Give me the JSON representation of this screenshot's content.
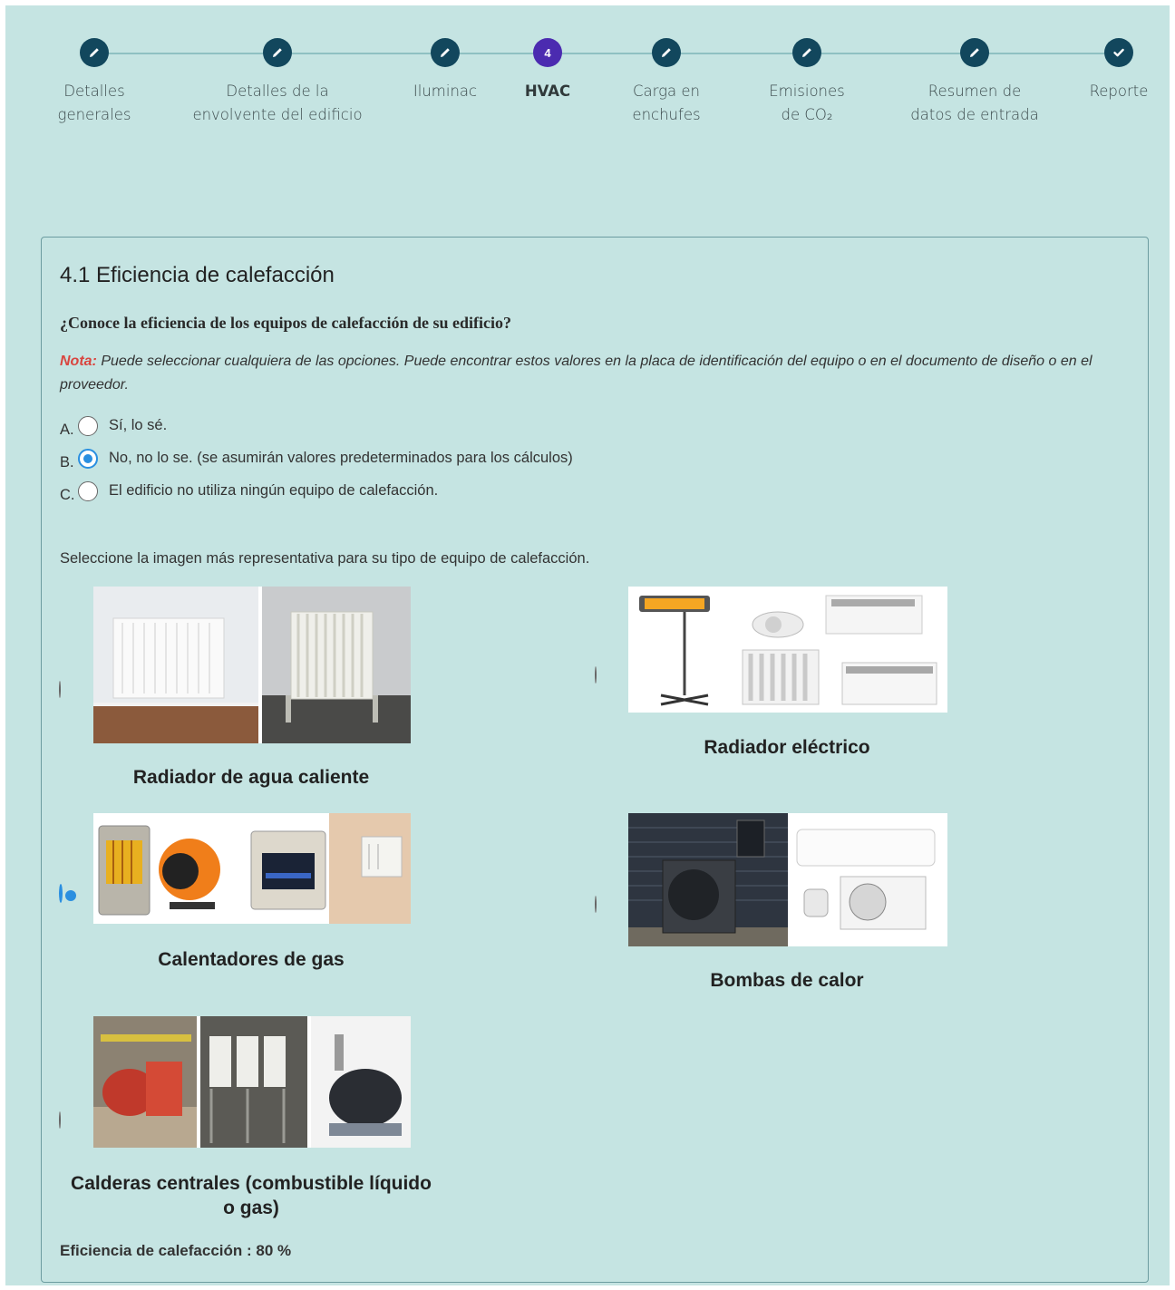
{
  "stepper": {
    "steps": [
      {
        "label": "Detalles\ngenerales",
        "icon": "pencil-icon",
        "state": "done"
      },
      {
        "label": "Detalles de la\nenvolvente del edificio",
        "icon": "pencil-icon",
        "state": "done"
      },
      {
        "label": "Iluminac",
        "icon": "pencil-icon",
        "state": "done"
      },
      {
        "label": "HVAC",
        "number": "4",
        "state": "active"
      },
      {
        "label": "Carga en\nenchufes",
        "icon": "pencil-icon",
        "state": "done"
      },
      {
        "label": "Emisiones\nde CO₂",
        "icon": "pencil-icon",
        "state": "done"
      },
      {
        "label": "Resumen de\ndatos de entrada",
        "icon": "pencil-icon",
        "state": "done"
      },
      {
        "label": "Reporte",
        "icon": "check-icon",
        "state": "done"
      }
    ]
  },
  "section": {
    "title": "4.1 Eficiencia de calefacción",
    "question": "¿Conoce la eficiencia de los equipos de calefacción de su edificio?",
    "note_prefix": "Nota:",
    "note_text": " Puede seleccionar cualquiera de las opciones. Puede encontrar estos valores en la placa de identificación del equipo o en el documento de diseño o en el proveedor.",
    "options": [
      {
        "letter": "A.",
        "label": "Sí, lo sé.",
        "checked": false
      },
      {
        "letter": "B.",
        "label": "No, no lo se. (se asumirán valores predeterminados para los cálculos)",
        "checked": true
      },
      {
        "letter": "C.",
        "label": "El edificio no utiliza ningún equipo de calefacción.",
        "checked": false
      }
    ],
    "select_prompt": "Seleccione la imagen más representativa para su tipo de equipo de calefacción.",
    "equipment": [
      {
        "name": "Radiador de agua caliente",
        "checked": false
      },
      {
        "name": "Radiador eléctrico",
        "checked": false
      },
      {
        "name": "Calentadores de gas",
        "checked": true
      },
      {
        "name": "Bombas de calor",
        "checked": false
      },
      {
        "name": "Calderas centrales (combustible líquido o gas)",
        "checked": false
      }
    ],
    "efficiency": "Eficiencia de calefacción : 80 %"
  },
  "colors": {
    "background": "#c5e4e2",
    "step_done": "#12475d",
    "step_active": "#4b2bb0",
    "radio_checked": "#2a8fe0",
    "note_red": "#d9453f"
  }
}
